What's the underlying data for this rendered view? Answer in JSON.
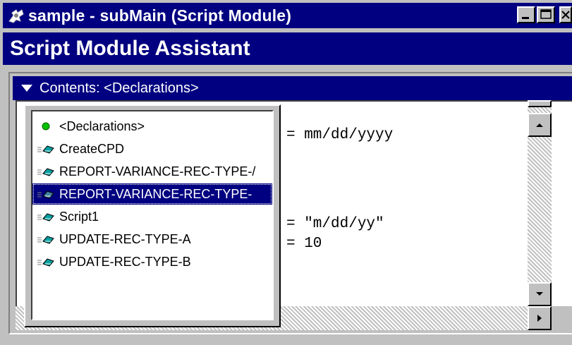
{
  "window": {
    "title": "sample - subMain (Script Module)",
    "controls": [
      "minimize-icon",
      "maximize-icon",
      "close-icon"
    ]
  },
  "assistant": {
    "title": "Script Module Assistant",
    "contents_label": "Contents: <Declarations>"
  },
  "editor": {
    "lines": [
      {
        "text": "= mm/dd/yyyy"
      },
      {
        "text": "= \"m/dd/yy\""
      },
      {
        "text": "= 10"
      }
    ]
  },
  "dropdown": {
    "items": [
      {
        "label": "<Declarations>",
        "icon": "green-dot-icon",
        "selected": false
      },
      {
        "label": "CreateCPD",
        "icon": "procedure-icon",
        "selected": false
      },
      {
        "label": "REPORT-VARIANCE-REC-TYPE-/",
        "icon": "procedure-icon",
        "selected": false
      },
      {
        "label": "REPORT-VARIANCE-REC-TYPE-",
        "icon": "procedure-icon",
        "selected": true
      },
      {
        "label": "Script1",
        "icon": "procedure-icon",
        "selected": false
      },
      {
        "label": "UPDATE-REC-TYPE-A",
        "icon": "procedure-icon",
        "selected": false
      },
      {
        "label": "UPDATE-REC-TYPE-B",
        "icon": "procedure-icon",
        "selected": false
      }
    ]
  },
  "colors": {
    "title_bar": "#000080",
    "face": "#c0c0c0",
    "selection": "#000080",
    "dot": "#00c000",
    "proc_icon": "#00a0a0"
  }
}
